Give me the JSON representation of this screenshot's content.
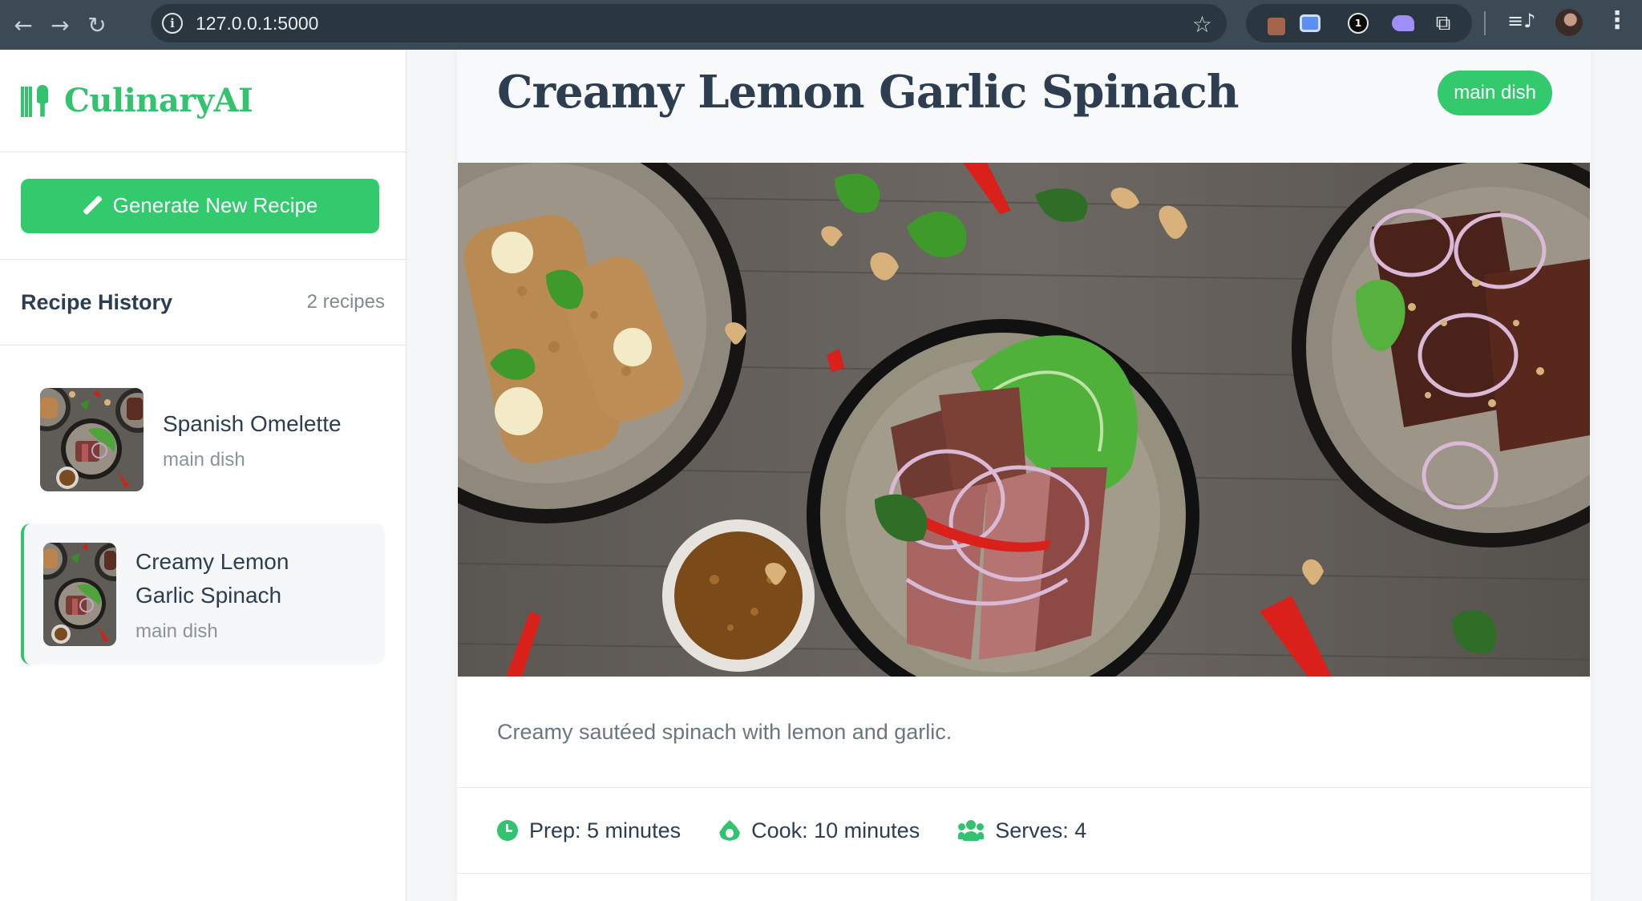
{
  "browser": {
    "url": "127.0.0.1:5000",
    "back_icon": "arrow-left-icon",
    "forward_icon": "arrow-right-icon",
    "reload_icon": "reload-icon",
    "star_icon": "star-icon",
    "menu_icon": "kebab-menu-icon",
    "extension_badge": "1"
  },
  "sidebar": {
    "brand": "CulinaryAI",
    "generate_button": "Generate New Recipe",
    "history_title": "Recipe History",
    "history_count": "2 recipes",
    "items": [
      {
        "name": "Spanish Omelette",
        "category": "main dish",
        "active": false
      },
      {
        "name": "Creamy Lemon Garlic Spinach",
        "category": "main dish",
        "active": true
      }
    ]
  },
  "recipe": {
    "title": "Creamy Lemon Garlic Spinach",
    "category": "main dish",
    "description": "Creamy sautéed spinach with lemon and garlic.",
    "meta": {
      "prep": "Prep: 5 minutes",
      "cook": "Cook: 10 minutes",
      "serves": "Serves: 4"
    }
  },
  "colors": {
    "accent": "#33c96d",
    "heading": "#2c3e50",
    "muted": "#7f8c8d",
    "chrome": "#3c4a55"
  }
}
